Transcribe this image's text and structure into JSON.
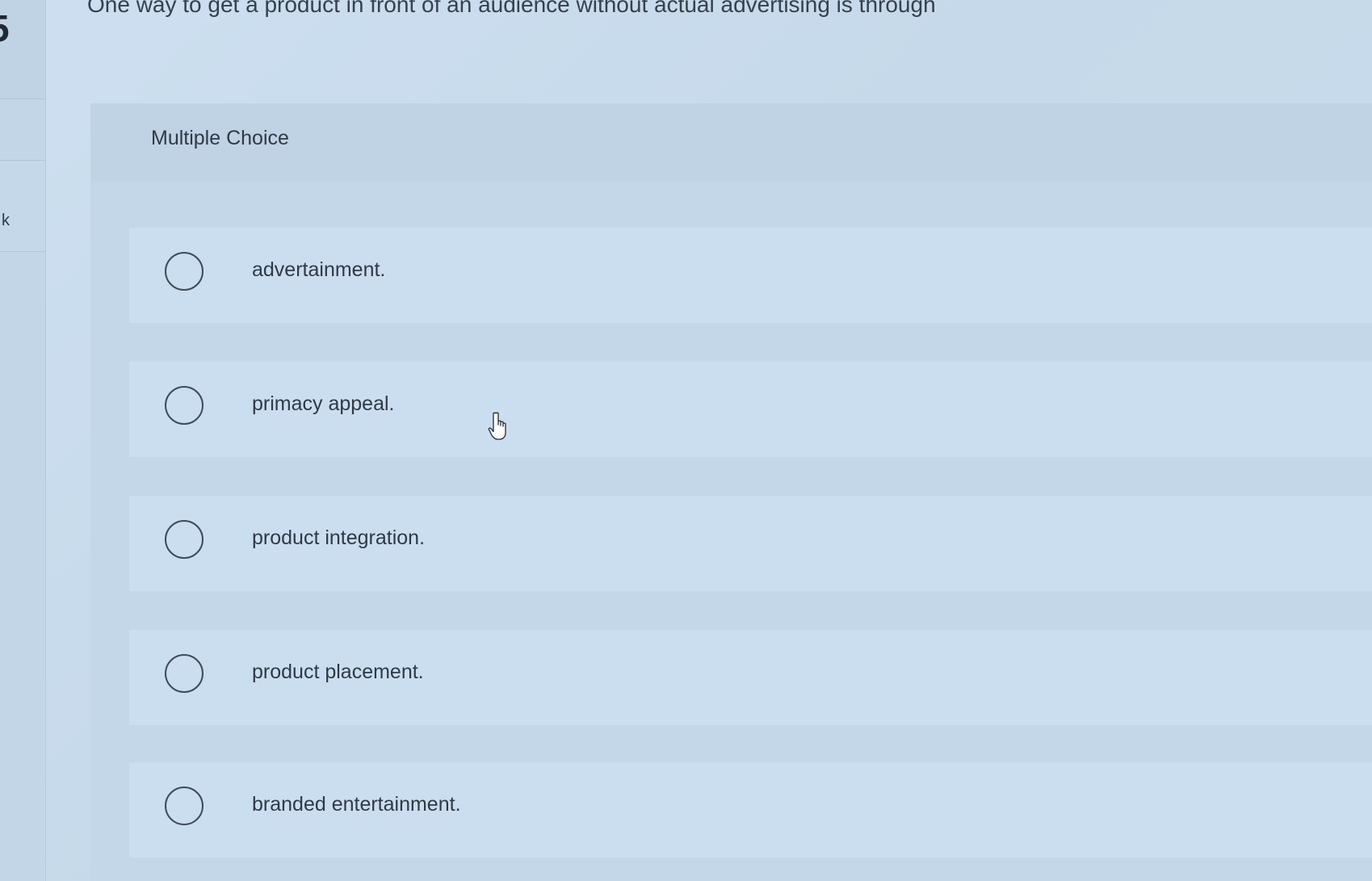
{
  "sidebar": {
    "question_number": "5",
    "partial_letter": "k"
  },
  "question": {
    "text": "One way to get a product in front of an audience without actual advertising is through"
  },
  "question_type": "Multiple Choice",
  "options": [
    {
      "label": "advertainment."
    },
    {
      "label": "primacy appeal."
    },
    {
      "label": "product integration."
    },
    {
      "label": "product placement."
    },
    {
      "label": "branded entertainment."
    }
  ],
  "icons": {
    "cursor": "hand-pointer-icon",
    "radio": "radio-circle-icon"
  },
  "colors": {
    "background": "#c9dbe9",
    "text": "#2f3a45",
    "radio_border": "#3f4b57"
  }
}
